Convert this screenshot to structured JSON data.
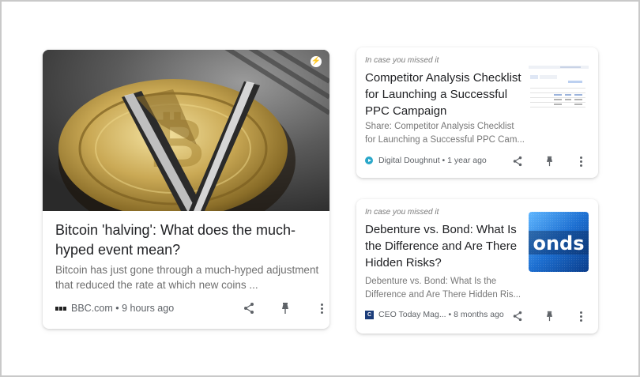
{
  "colors": {
    "title_text": "#202124",
    "snippet_text": "#6f6f6f",
    "meta_text": "#5f6368",
    "digital_doughnut_icon": "#2aa7c9"
  },
  "main_story": {
    "image_icon": "bitcoin-coin-image",
    "badge_icon": "amp-lightning-icon",
    "title": "Bitcoin 'halving': What does the much-hyped event mean?",
    "snippet": "Bitcoin has just gone through a much-hyped adjustment that reduced the rate at which new coins ...",
    "source_icon": "bbc-logo-icon",
    "source": "BBC.com",
    "time": "9 hours ago",
    "actions": [
      "share-icon",
      "pin-icon",
      "more-vert-icon"
    ]
  },
  "side_stories": [
    {
      "kicker": "In case you missed it",
      "title": "Competitor Analysis Checklist for Launching a Successful PPC Campaign",
      "snippet": "Share: Competitor Analysis Checklist for Launching a Successful PPC Cam...",
      "source_icon": "digital-doughnut-icon",
      "source": "Digital Doughnut",
      "time": "1 year ago",
      "thumbnail_icon": "spreadsheet-screenshot-thumbnail",
      "actions": [
        "share-icon",
        "pin-icon",
        "more-vert-icon"
      ]
    },
    {
      "kicker": "In case you missed it",
      "title": "Debenture vs. Bond: What Is the Difference and Are There Hidden Risks?",
      "snippet": "Debenture vs. Bond: What Is the Difference and Are There Hidden Ris...",
      "source_icon": "ceo-today-icon",
      "source": "CEO Today Mag...",
      "time": "8 months ago",
      "thumbnail_icon": "bonds-screen-thumbnail",
      "thumbnail_text": "onds",
      "actions": [
        "share-icon",
        "pin-icon",
        "more-vert-icon"
      ]
    }
  ]
}
